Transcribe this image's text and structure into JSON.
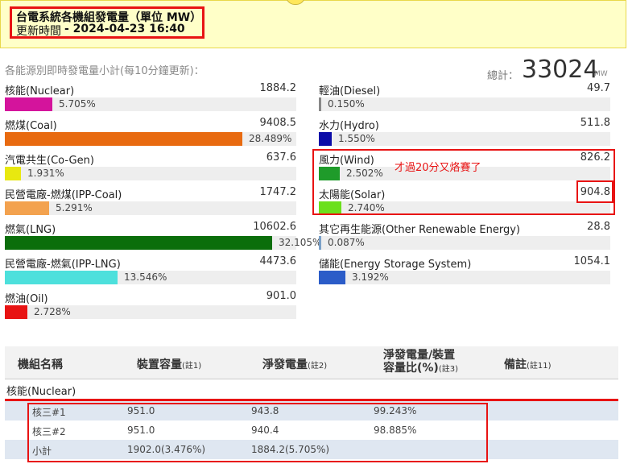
{
  "header": {
    "title": "台電系統各機組發電量（單位 MW）",
    "updated_label": "更新時間",
    "updated_time": "- 2024-04-23 16:40"
  },
  "summary": {
    "subtitle": "各能源別即時發電量小計(每10分鐘更新)：",
    "total_label": "總計：",
    "total_value": "33024",
    "total_unit": "MW"
  },
  "energy_left": [
    {
      "name": "核能(Nuclear)",
      "value": "1884.2",
      "pct": "5.705%",
      "fraction": 0.05705,
      "color": "#d4149c"
    },
    {
      "name": "燃煤(Coal)",
      "value": "9408.5",
      "pct": "28.489%",
      "fraction": 0.28489,
      "color": "#e86a10"
    },
    {
      "name": "汽電共生(Co-Gen)",
      "value": "637.6",
      "pct": "1.931%",
      "fraction": 0.01931,
      "color": "#e8e810"
    },
    {
      "name": "民營電廠-燃煤(IPP-Coal)",
      "value": "1747.2",
      "pct": "5.291%",
      "fraction": 0.05291,
      "color": "#f3a24f"
    },
    {
      "name": "燃氣(LNG)",
      "value": "10602.6",
      "pct": "32.105%",
      "fraction": 0.32105,
      "color": "#0b6e0b"
    },
    {
      "name": "民營電廠-燃氣(IPP-LNG)",
      "value": "4473.6",
      "pct": "13.546%",
      "fraction": 0.13546,
      "color": "#4de0dc"
    },
    {
      "name": "燃油(Oil)",
      "value": "901.0",
      "pct": "2.728%",
      "fraction": 0.02728,
      "color": "#e81313"
    }
  ],
  "energy_right": [
    {
      "name": "輕油(Diesel)",
      "value": "49.7",
      "pct": "0.150%",
      "fraction": 0.0015,
      "color": "#888888"
    },
    {
      "name": "水力(Hydro)",
      "value": "511.8",
      "pct": "1.550%",
      "fraction": 0.0155,
      "color": "#0c0ca8"
    },
    {
      "name": "風力(Wind)",
      "value": "826.2",
      "pct": "2.502%",
      "fraction": 0.02502,
      "color": "#1f9b2a"
    },
    {
      "name": "太陽能(Solar)",
      "value": "904.8",
      "pct": "2.740%",
      "fraction": 0.0274,
      "color": "#6be01c"
    },
    {
      "name": "其它再生能源(Other Renewable Energy)",
      "value": "28.8",
      "pct": "0.087%",
      "fraction": 0.00087,
      "color": "#7aa0c8"
    },
    {
      "name": "儲能(Energy Storage System)",
      "value": "1054.1",
      "pct": "3.192%",
      "fraction": 0.03192,
      "color": "#2b5cc8"
    }
  ],
  "annotation": "才過20分又烙賽了",
  "table": {
    "headers": {
      "name": "機組名稱",
      "capacity": "裝置容量",
      "capacity_note": "(註1)",
      "net": "淨發電量",
      "net_note": "(註2)",
      "ratio_line1": "淨發電量/裝置",
      "ratio_line2": "容量比(%)",
      "ratio_note": "(註3)",
      "remark": "備註",
      "remark_note": "(註11)"
    },
    "section": "核能(Nuclear)",
    "rows": [
      {
        "name": "核三#1",
        "capacity": "951.0",
        "net": "943.8",
        "ratio": "99.243%"
      },
      {
        "name": "核三#2",
        "capacity": "951.0",
        "net": "940.4",
        "ratio": "98.885%"
      },
      {
        "name": "小計",
        "capacity": "1902.0(3.476%)",
        "net": "1884.2(5.705%)",
        "ratio": ""
      }
    ]
  }
}
